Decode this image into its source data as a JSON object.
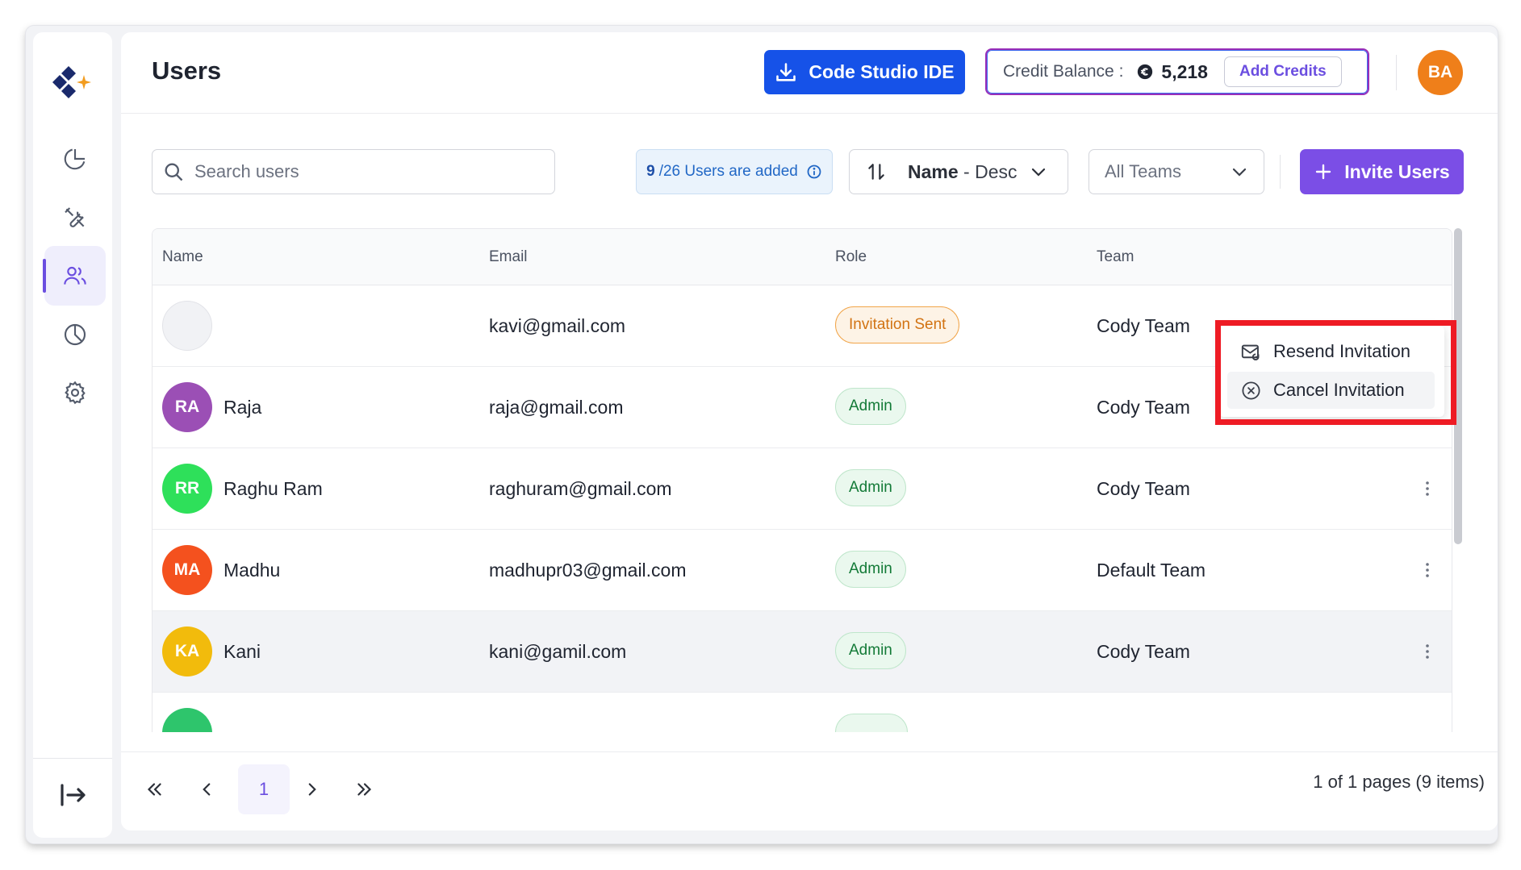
{
  "page_title": "Users",
  "header": {
    "ide_button": "Code Studio IDE",
    "credit_label": "Credit Balance :",
    "credit_value": "5,218",
    "add_credits": "Add Credits",
    "avatar_initials": "BA"
  },
  "toolbar": {
    "search_placeholder": "Search users",
    "users_added_count": "9",
    "users_added_rest": "/26 Users are added",
    "sort_label": "Name",
    "sort_direction": "- Desc",
    "team_filter": "All Teams",
    "invite_button": "Invite Users"
  },
  "table": {
    "columns": [
      "Name",
      "Email",
      "Role",
      "Team"
    ],
    "rows": [
      {
        "initials": "",
        "name": "",
        "email": "kavi@gmail.com",
        "role": "Invitation Sent",
        "team": "Cody Team",
        "avatar_color": ""
      },
      {
        "initials": "RA",
        "name": "Raja",
        "email": "raja@gmail.com",
        "role": "Admin",
        "team": "Cody Team",
        "avatar_color": "#9b4fb5"
      },
      {
        "initials": "RR",
        "name": "Raghu Ram",
        "email": "raghuram@gmail.com",
        "role": "Admin",
        "team": "Cody Team",
        "avatar_color": "#2ee05a"
      },
      {
        "initials": "MA",
        "name": "Madhu",
        "email": "madhupr03@gmail.com",
        "role": "Admin",
        "team": "Default Team",
        "avatar_color": "#f4511e"
      },
      {
        "initials": "KA",
        "name": "Kani",
        "email": "kani@gamil.com",
        "role": "Admin",
        "team": "Cody Team",
        "avatar_color": "#f2bb0c"
      }
    ]
  },
  "context_menu": {
    "resend": "Resend Invitation",
    "cancel": "Cancel Invitation"
  },
  "pagination": {
    "current_page": "1",
    "info": "1 of 1 pages (9 items)"
  },
  "colors": {
    "accent": "#7b4ee6",
    "ide_blue": "#1652e8",
    "highlight_red": "#ee1b24"
  }
}
